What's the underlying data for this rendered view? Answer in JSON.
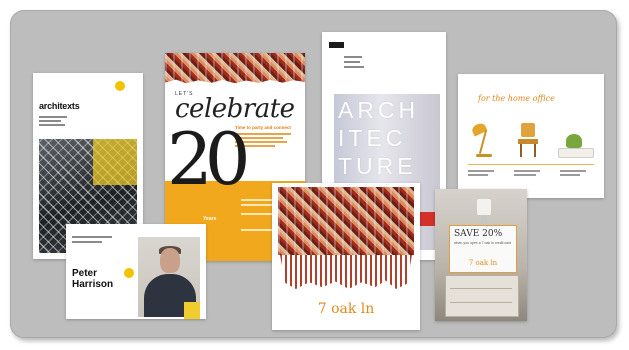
{
  "cards": {
    "architexts": {
      "title": "architexts",
      "badge": ""
    },
    "celebrate": {
      "lets": "LET'S",
      "word": "celebrate",
      "number": "20",
      "years": "Years",
      "tagline": "Time to party and connect"
    },
    "architecture": {
      "badge": "",
      "text_lines": [
        "ARCH",
        "ITEC",
        "TURE"
      ]
    },
    "home_office": {
      "title": "for the home office"
    },
    "peter": {
      "name_line1": "Peter",
      "name_line2": "Harrison"
    },
    "oak": {
      "brand": "7 oak ln"
    },
    "save": {
      "headline": "SAVE 20%",
      "subline": "when you open a 7 oak ln credit card",
      "brand": "7 oak ln"
    }
  },
  "colors": {
    "accent_orange": "#e18a1c",
    "accent_yellow": "#f0cd2e",
    "frame_gray": "#bdbdbd",
    "red_tab": "#d4302a"
  }
}
